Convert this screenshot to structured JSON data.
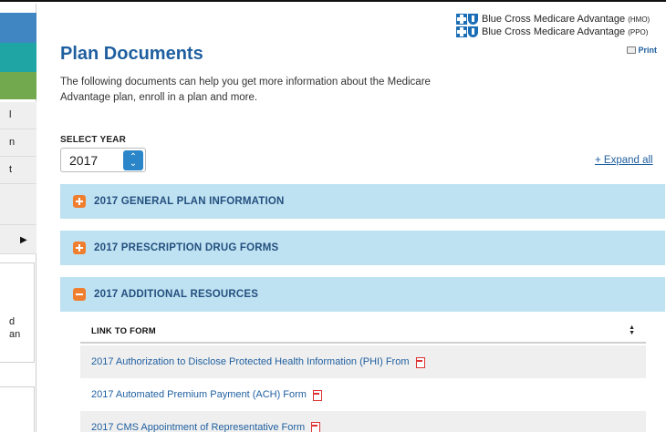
{
  "sidebar": {
    "fragments": [
      "l",
      "n",
      "t",
      "d",
      "an"
    ]
  },
  "header": {
    "title": "Plan Documents",
    "intro": "The following documents can help you get more information about the Medicare Advantage plan, enroll in a plan and more.",
    "brand_lines": [
      {
        "text": "Blue Cross Medicare Advantage",
        "suffix": "(HMO)"
      },
      {
        "text": "Blue Cross Medicare Advantage",
        "suffix": "(PPO)"
      }
    ],
    "print_label": "Print"
  },
  "year_select": {
    "label": "SELECT YEAR",
    "value": "2017"
  },
  "expand_all": "+ Expand all",
  "sections": [
    {
      "title": "2017 GENERAL PLAN INFORMATION",
      "state": "collapsed"
    },
    {
      "title": "2017 PRESCRIPTION DRUG FORMS",
      "state": "collapsed"
    },
    {
      "title": "2017 ADDITIONAL RESOURCES",
      "state": "expanded"
    }
  ],
  "table": {
    "column_header": "LINK TO FORM",
    "rows": [
      "2017 Authorization to Disclose Protected Health Information (PHI) From",
      "2017 Automated Premium Payment (ACH) Form",
      "2017 CMS Appointment of Representative Form"
    ]
  },
  "colors": {
    "title_blue": "#1f5f9f",
    "accordion_bg": "#bfe2f2",
    "accordion_icon": "#ef7f2f",
    "select_button": "#2a86c8"
  }
}
